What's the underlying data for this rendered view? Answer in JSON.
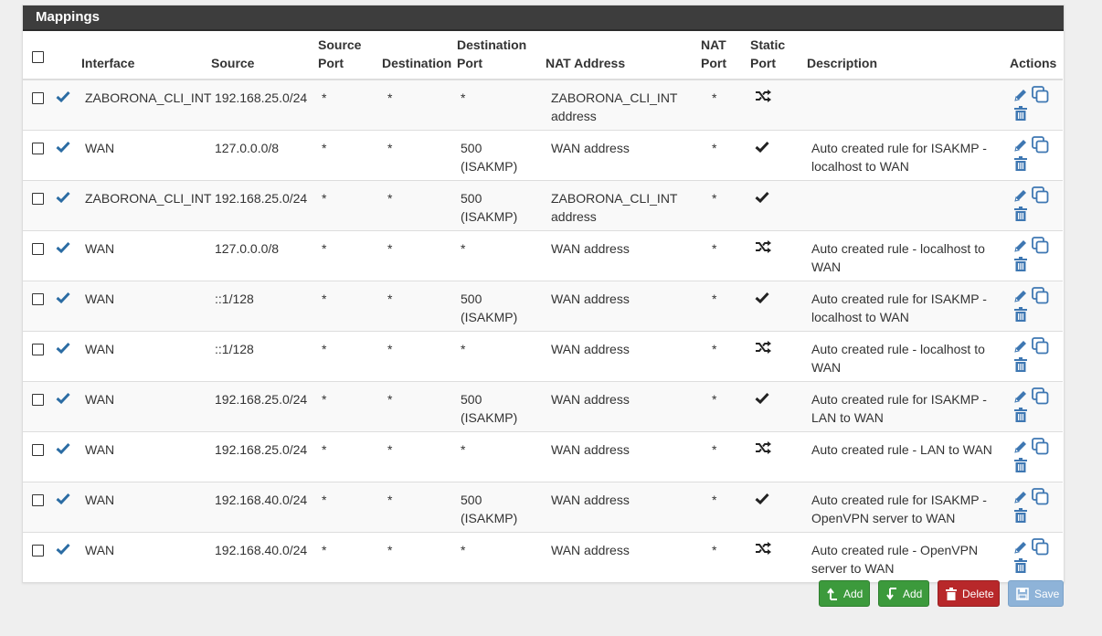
{
  "panel": {
    "title": "Mappings"
  },
  "columns": {
    "interface": "Interface",
    "source": "Source",
    "source_port": [
      "Source",
      "Port"
    ],
    "destination": "Destination",
    "destination_port": [
      "Destination",
      "Port"
    ],
    "nat_address": "NAT Address",
    "nat_port": [
      "NAT",
      "Port"
    ],
    "static_port": [
      "Static",
      "Port"
    ],
    "description": "Description",
    "actions": "Actions"
  },
  "rows": [
    {
      "interface": "ZABORONA_CLI_INT",
      "source": "192.168.25.0/24",
      "source_port": "*",
      "destination": "*",
      "dest_port": [
        "*",
        ""
      ],
      "nat_address": [
        "ZABORONA_CLI_INT",
        "address"
      ],
      "nat_port": "*",
      "static_port": "shuffle-icon",
      "description": [
        "",
        ""
      ]
    },
    {
      "interface": "WAN",
      "source": "127.0.0.0/8",
      "source_port": "*",
      "destination": "*",
      "dest_port": [
        "500",
        "(ISAKMP)"
      ],
      "nat_address": [
        "WAN address",
        ""
      ],
      "nat_port": "*",
      "static_port": "check-icon",
      "description": [
        "Auto created rule for ISAKMP -",
        "localhost to WAN"
      ]
    },
    {
      "interface": "ZABORONA_CLI_INT",
      "source": "192.168.25.0/24",
      "source_port": "*",
      "destination": "*",
      "dest_port": [
        "500",
        "(ISAKMP)"
      ],
      "nat_address": [
        "ZABORONA_CLI_INT",
        "address"
      ],
      "nat_port": "*",
      "static_port": "check-icon",
      "description": [
        "",
        ""
      ]
    },
    {
      "interface": "WAN",
      "source": "127.0.0.0/8",
      "source_port": "*",
      "destination": "*",
      "dest_port": [
        "*",
        ""
      ],
      "nat_address": [
        "WAN address",
        ""
      ],
      "nat_port": "*",
      "static_port": "shuffle-icon",
      "description": [
        "Auto created rule - localhost to",
        "WAN"
      ]
    },
    {
      "interface": "WAN",
      "source": "::1/128",
      "source_port": "*",
      "destination": "*",
      "dest_port": [
        "500",
        "(ISAKMP)"
      ],
      "nat_address": [
        "WAN address",
        ""
      ],
      "nat_port": "*",
      "static_port": "check-icon",
      "description": [
        "Auto created rule for ISAKMP -",
        "localhost to WAN"
      ]
    },
    {
      "interface": "WAN",
      "source": "::1/128",
      "source_port": "*",
      "destination": "*",
      "dest_port": [
        "*",
        ""
      ],
      "nat_address": [
        "WAN address",
        ""
      ],
      "nat_port": "*",
      "static_port": "shuffle-icon",
      "description": [
        "Auto created rule - localhost to",
        "WAN"
      ]
    },
    {
      "interface": "WAN",
      "source": "192.168.25.0/24",
      "source_port": "*",
      "destination": "*",
      "dest_port": [
        "500",
        "(ISAKMP)"
      ],
      "nat_address": [
        "WAN address",
        ""
      ],
      "nat_port": "*",
      "static_port": "check-icon",
      "description": [
        "Auto created rule for ISAKMP -",
        "LAN to WAN"
      ]
    },
    {
      "interface": "WAN",
      "source": "192.168.25.0/24",
      "source_port": "*",
      "destination": "*",
      "dest_port": [
        "*",
        ""
      ],
      "nat_address": [
        "WAN address",
        ""
      ],
      "nat_port": "*",
      "static_port": "shuffle-icon",
      "description": [
        "Auto created rule - LAN to WAN",
        ""
      ]
    },
    {
      "interface": "WAN",
      "source": "192.168.40.0/24",
      "source_port": "*",
      "destination": "*",
      "dest_port": [
        "500",
        "(ISAKMP)"
      ],
      "nat_address": [
        "WAN address",
        ""
      ],
      "nat_port": "*",
      "static_port": "check-icon",
      "description": [
        "Auto created rule for ISAKMP -",
        "OpenVPN server to WAN"
      ]
    },
    {
      "interface": "WAN",
      "source": "192.168.40.0/24",
      "source_port": "*",
      "destination": "*",
      "dest_port": [
        "*",
        ""
      ],
      "nat_address": [
        "WAN address",
        ""
      ],
      "nat_port": "*",
      "static_port": "shuffle-icon",
      "description": [
        "Auto created rule - OpenVPN",
        "server to WAN"
      ]
    }
  ],
  "buttons": {
    "add_top": "Add",
    "add_bottom": "Add",
    "delete": "Delete",
    "save": "Save"
  },
  "colors": {
    "header_bg": "#3d3d3d",
    "accent_blue": "#2b6ca3",
    "add_green": "#3c9a3c",
    "delete_red": "#b8282a",
    "save_blue": "#8eb3d8"
  }
}
